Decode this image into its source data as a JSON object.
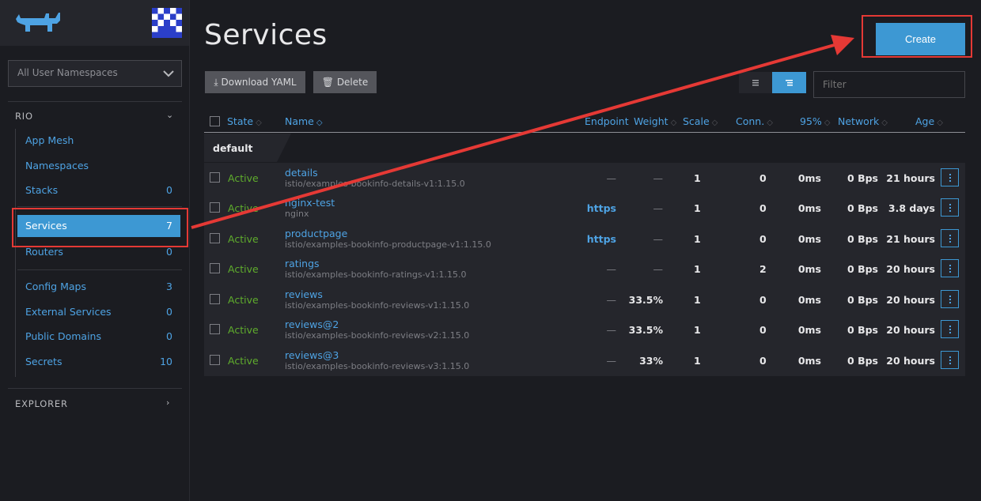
{
  "sidebar": {
    "namespace_select": "All User Namespaces",
    "rio_group": "RIO",
    "explorer_group": "EXPLORER",
    "items": [
      {
        "label": "App Mesh",
        "count": ""
      },
      {
        "label": "Namespaces",
        "count": ""
      },
      {
        "label": "Stacks",
        "count": "0"
      },
      {
        "label": "Services",
        "count": "7"
      },
      {
        "label": "Routers",
        "count": "0"
      },
      {
        "label": "Config Maps",
        "count": "3"
      },
      {
        "label": "External Services",
        "count": "0"
      },
      {
        "label": "Public Domains",
        "count": "0"
      },
      {
        "label": "Secrets",
        "count": "10"
      }
    ]
  },
  "main": {
    "title": "Services",
    "create_label": "Create",
    "download_label": "Download YAML",
    "delete_label": "Delete",
    "filter_placeholder": "Filter",
    "columns": {
      "state": "State",
      "name": "Name",
      "endpoint": "Endpoint",
      "weight": "Weight",
      "scale": "Scale",
      "conn": "Conn.",
      "p95": "95%",
      "network": "Network",
      "age": "Age"
    },
    "group": "default",
    "rows": [
      {
        "state": "Active",
        "name": "details",
        "image": "istio/examples-bookinfo-details-v1:1.15.0",
        "endpoint": "—",
        "weight": "—",
        "scale": "1",
        "conn": "0",
        "p95": "0ms",
        "network": "0 Bps",
        "age": "21 hours"
      },
      {
        "state": "Active",
        "name": "nginx-test",
        "image": "nginx",
        "endpoint": "https",
        "weight": "—",
        "scale": "1",
        "conn": "0",
        "p95": "0ms",
        "network": "0 Bps",
        "age": "3.8 days"
      },
      {
        "state": "Active",
        "name": "productpage",
        "image": "istio/examples-bookinfo-productpage-v1:1.15.0",
        "endpoint": "https",
        "weight": "—",
        "scale": "1",
        "conn": "0",
        "p95": "0ms",
        "network": "0 Bps",
        "age": "21 hours"
      },
      {
        "state": "Active",
        "name": "ratings",
        "image": "istio/examples-bookinfo-ratings-v1:1.15.0",
        "endpoint": "—",
        "weight": "—",
        "scale": "1",
        "conn": "2",
        "p95": "0ms",
        "network": "0 Bps",
        "age": "20 hours"
      },
      {
        "state": "Active",
        "name": "reviews",
        "image": "istio/examples-bookinfo-reviews-v1:1.15.0",
        "endpoint": "—",
        "weight": "33.5%",
        "scale": "1",
        "conn": "0",
        "p95": "0ms",
        "network": "0 Bps",
        "age": "20 hours"
      },
      {
        "state": "Active",
        "name": "reviews@2",
        "image": "istio/examples-bookinfo-reviews-v2:1.15.0",
        "endpoint": "—",
        "weight": "33.5%",
        "scale": "1",
        "conn": "0",
        "p95": "0ms",
        "network": "0 Bps",
        "age": "20 hours"
      },
      {
        "state": "Active",
        "name": "reviews@3",
        "image": "istio/examples-bookinfo-reviews-v3:1.15.0",
        "endpoint": "—",
        "weight": "33%",
        "scale": "1",
        "conn": "0",
        "p95": "0ms",
        "network": "0 Bps",
        "age": "20 hours"
      }
    ]
  },
  "icons": {
    "logo": "rancher-cow-logo",
    "avatar": "identicon-avatar",
    "sort": "sort-icon",
    "kebab": "more-vertical-icon"
  },
  "colors": {
    "accent": "#3d98d3",
    "link": "#4ea3e4",
    "active_state": "#5fad2c",
    "annotation": "#e53935"
  }
}
